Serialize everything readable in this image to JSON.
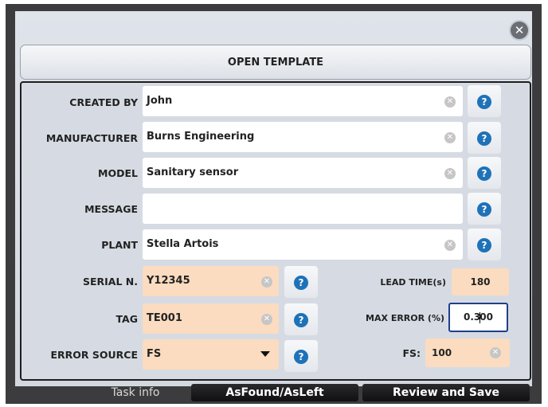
{
  "header": {
    "open_template_label": "OPEN TEMPLATE",
    "close_glyph": "✕"
  },
  "fields": {
    "created_by": {
      "label": "CREATED BY",
      "value": "John"
    },
    "manufacturer": {
      "label": "MANUFACTURER",
      "value": "Burns Engineering"
    },
    "model": {
      "label": "MODEL",
      "value": "Sanitary sensor"
    },
    "message": {
      "label": "MESSAGE",
      "value": ""
    },
    "plant": {
      "label": "PLANT",
      "value": "Stella Artois"
    },
    "serial": {
      "label": "SERIAL N.",
      "value": "Y12345"
    },
    "tag": {
      "label": "TAG",
      "value": "TE001"
    },
    "error_source": {
      "label": "ERROR SOURCE",
      "value": "FS"
    },
    "lead_time": {
      "label": "LEAD TIME(s)",
      "value": "180"
    },
    "max_error": {
      "label": "MAX ERROR (%)",
      "value_before_caret": "0.3",
      "value_after_caret": "00"
    },
    "fs": {
      "label": "FS:",
      "value": "100"
    }
  },
  "icons": {
    "clear_glyph": "✕",
    "help_glyph": "?"
  },
  "tabs": [
    {
      "label": "Task info",
      "active": true
    },
    {
      "label": "AsFound/AsLeft",
      "active": false
    },
    {
      "label": "Review and Save",
      "active": false
    }
  ],
  "colors": {
    "frame": "#3c3c3e",
    "orange_field": "#fbdcc0",
    "help_blue": "#1e72b8",
    "active_border": "#1f3f8a"
  }
}
